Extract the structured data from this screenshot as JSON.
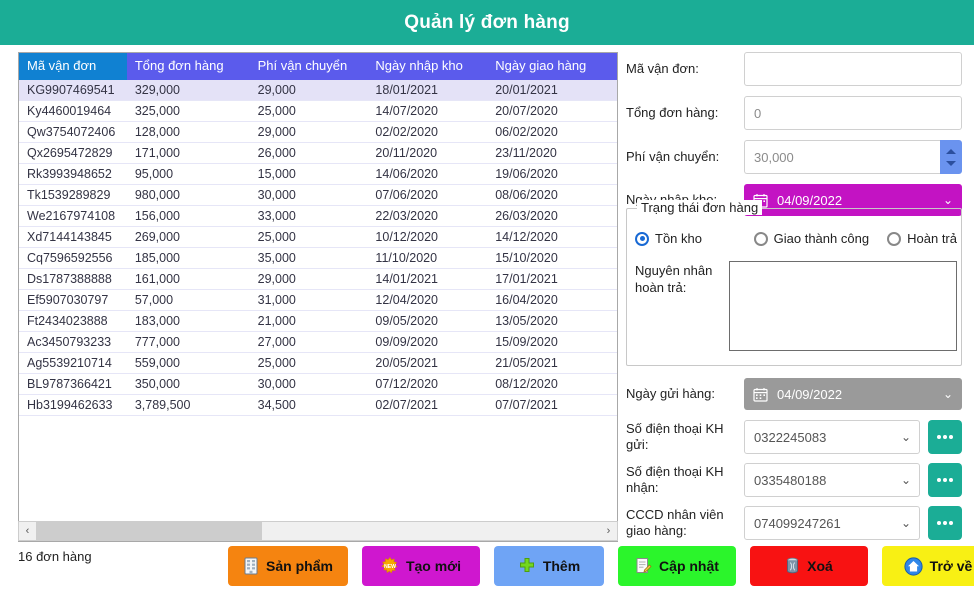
{
  "header": {
    "title": "Quản lý đơn hàng",
    "accent": "#1bad96"
  },
  "table": {
    "columns": [
      "Mã vận đơn",
      "Tổng đơn hàng",
      "Phí vận chuyển",
      "Ngày nhập kho",
      "Ngày giao hàng"
    ],
    "selected_column": "Mã vận đơn",
    "selected_row_index": 0,
    "rows": [
      [
        "KG9907469541",
        "329,000",
        "29,000",
        "18/01/2021",
        "20/01/2021"
      ],
      [
        "Ky4460019464",
        "325,000",
        "25,000",
        "14/07/2020",
        "20/07/2020"
      ],
      [
        "Qw3754072406",
        "128,000",
        "29,000",
        "02/02/2020",
        "06/02/2020"
      ],
      [
        "Qx2695472829",
        "171,000",
        "26,000",
        "20/11/2020",
        "23/11/2020"
      ],
      [
        "Rk3993948652",
        "95,000",
        "15,000",
        "14/06/2020",
        "19/06/2020"
      ],
      [
        "Tk1539289829",
        "980,000",
        "30,000",
        "07/06/2020",
        "08/06/2020"
      ],
      [
        "We2167974108",
        "156,000",
        "33,000",
        "22/03/2020",
        "26/03/2020"
      ],
      [
        "Xd7144143845",
        "269,000",
        "25,000",
        "10/12/2020",
        "14/12/2020"
      ],
      [
        "Cq7596592556",
        "185,000",
        "35,000",
        "11/10/2020",
        "15/10/2020"
      ],
      [
        "Ds1787388888",
        "161,000",
        "29,000",
        "14/01/2021",
        "17/01/2021"
      ],
      [
        "Ef5907030797",
        "57,000",
        "31,000",
        "12/04/2020",
        "16/04/2020"
      ],
      [
        "Ft2434023888",
        "183,000",
        "21,000",
        "09/05/2020",
        "13/05/2020"
      ],
      [
        "Ac3450793233",
        "777,000",
        "27,000",
        "09/09/2020",
        "15/09/2020"
      ],
      [
        "Ag5539210714",
        "559,000",
        "25,000",
        "20/05/2021",
        "21/05/2021"
      ],
      [
        "BL9787366421",
        "350,000",
        "30,000",
        "07/12/2020",
        "08/12/2020"
      ],
      [
        "Hb3199462633",
        "3,789,500",
        "34,500",
        "02/07/2021",
        "07/07/2021"
      ]
    ]
  },
  "status": {
    "count_label": "16 đơn hàng"
  },
  "scrollbar": {
    "left_arrow": "‹",
    "right_arrow": "›"
  },
  "form": {
    "ma_van_don": {
      "label": "Mã vận đơn:",
      "value": "",
      "placeholder": ""
    },
    "tong_don_hang": {
      "label": "Tổng đơn hàng:",
      "value": "",
      "placeholder": "0"
    },
    "phi_van_chuyen": {
      "label": "Phí vận chuyển:",
      "value": "",
      "placeholder": "30,000"
    },
    "ngay_nhap_kho": {
      "label": "Ngày nhập kho:",
      "value": "04/09/2022",
      "color": "#c313c3",
      "chevron": "⌄"
    },
    "trang_thai": {
      "legend": "Trạng thái đơn hàng",
      "options": [
        "Tồn kho",
        "Giao thành công",
        "Hoàn trả"
      ],
      "selected": "Tồn kho"
    },
    "nguyen_nhan": {
      "label": "Nguyên nhân hoàn trả:",
      "value": ""
    },
    "ngay_gui_hang": {
      "label": "Ngày gửi hàng:",
      "value": "04/09/2022",
      "color": "#9a9a9a",
      "chevron": "⌄"
    },
    "sdt_kh_gui": {
      "label": "Số điện thoại KH gửi:",
      "value": "0322245083",
      "chevron": "⌄",
      "browse": "..."
    },
    "sdt_kh_nhan": {
      "label": "Số điện thoại KH nhận:",
      "value": "0335480188",
      "chevron": "⌄",
      "browse": "..."
    },
    "cccd_nhan_vien": {
      "label": "CCCD nhân viên giao hàng:",
      "value": "074099247261",
      "chevron": "⌄",
      "browse": "..."
    }
  },
  "buttons": [
    {
      "label": "Sản phẩm",
      "icon": "spreadsheet-icon",
      "color": "#f58410"
    },
    {
      "label": "Tạo mới",
      "icon": "new-star-icon",
      "color": "#cf17cf"
    },
    {
      "label": "Thêm",
      "icon": "plus-icon",
      "color": "#6fa4f5"
    },
    {
      "label": "Cập nhật",
      "icon": "edit-document-icon",
      "color": "#2bf52b"
    },
    {
      "label": "Xoá",
      "icon": "trash-icon",
      "color": "#f81212"
    },
    {
      "label": "Trở về",
      "icon": "home-icon",
      "color": "#f8f014"
    }
  ]
}
